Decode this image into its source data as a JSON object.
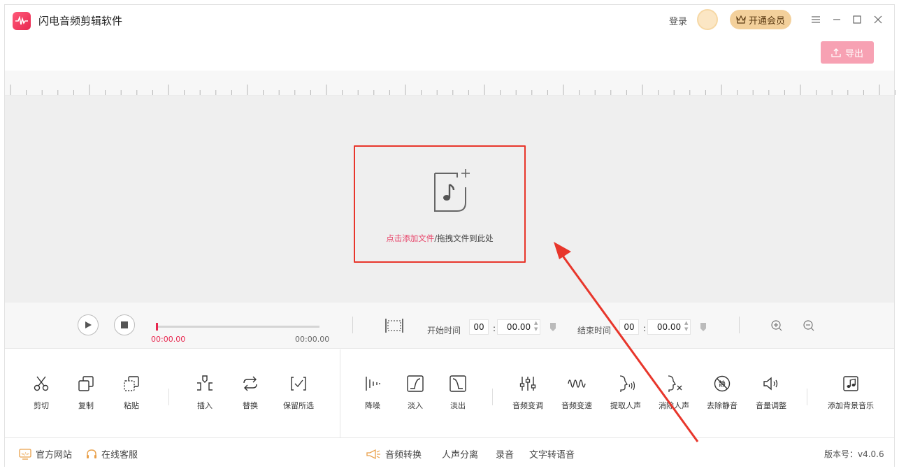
{
  "app": {
    "title": "闪电音频剪辑软件"
  },
  "header": {
    "login": "登录",
    "vip": "开通会员"
  },
  "toolbar": {
    "export": "导出"
  },
  "dropzone": {
    "add_link": "点击添加文件",
    "separator": "/",
    "drag_text": "拖拽文件到此处"
  },
  "player": {
    "current_time": "00:00.00",
    "total_time": "00:00.00",
    "start_label": "开始时间",
    "start_min": "00",
    "start_sec": "00.00",
    "end_label": "结束时间",
    "end_min": "00",
    "end_sec": "00.00",
    "colon": ":"
  },
  "tools": {
    "cut": "剪切",
    "copy": "复制",
    "paste": "粘贴",
    "insert": "插入",
    "replace": "替换",
    "keep": "保留所选",
    "denoise": "降噪",
    "fadein": "淡入",
    "fadeout": "淡出",
    "pitch": "音频变调",
    "speed": "音频变速",
    "extract": "提取人声",
    "remove_voice": "消除人声",
    "silence": "去除静音",
    "volume": "音量调整",
    "bgm": "添加背景音乐"
  },
  "footer": {
    "website": "官方网站",
    "support": "在线客服",
    "convert": "音频转换",
    "separate": "人声分离",
    "record": "录音",
    "tts": "文字转语音",
    "version": "版本号：v4.0.6"
  },
  "colors": {
    "accent": "#e8274f",
    "annotation": "#e8362b",
    "vip": "#f3d09b"
  }
}
